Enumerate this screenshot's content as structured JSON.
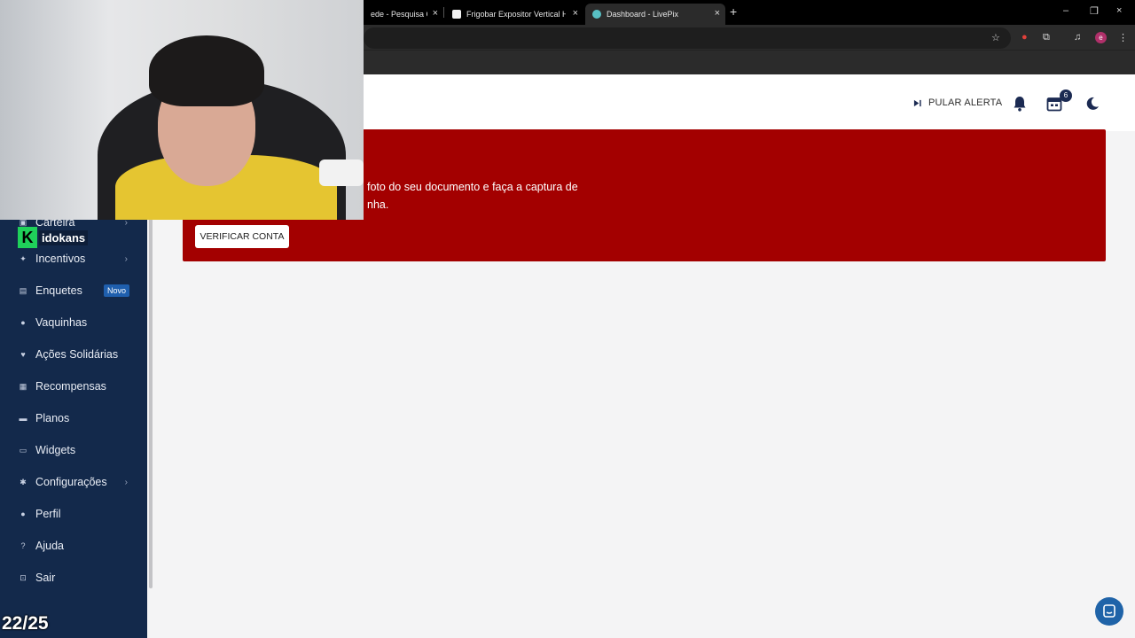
{
  "browser": {
    "tabs": [
      {
        "title": "ede - Pesquisa Go",
        "favicon_color": "#4285f4"
      },
      {
        "title": "Frigobar Expositor Vertical HQ",
        "favicon_color": "#f2f2f2"
      },
      {
        "title": "Dashboard - LivePix",
        "favicon_color": "#58c0c4"
      }
    ],
    "new_tab": "+",
    "close_glyph": "×",
    "window_controls": [
      "–",
      "❐",
      "×"
    ],
    "profile_initial": "e"
  },
  "topbar": {
    "skip_alert_label": "PULAR ALERTA",
    "calendar_badge": "6"
  },
  "alert": {
    "line1": "foto do seu documento e faça a captura de",
    "line2": "nha.",
    "verify_button": "VERIFICAR CONTA"
  },
  "sidebar": {
    "partial_item": "Carteira",
    "items": [
      {
        "label": "Incentivos",
        "icon": "sparkle-icon",
        "has_submenu": true
      },
      {
        "label": "Enquetes",
        "icon": "poll-icon",
        "badge": "Novo"
      },
      {
        "label": "Vaquinhas",
        "icon": "piggy-bank-icon"
      },
      {
        "label": "Ações Solidárias",
        "icon": "hand-heart-icon"
      },
      {
        "label": "Recompensas",
        "icon": "gift-icon"
      },
      {
        "label": "Planos",
        "icon": "ticket-icon"
      },
      {
        "label": "Widgets",
        "icon": "monitor-icon"
      },
      {
        "label": "Configurações",
        "icon": "gear-icon",
        "has_submenu": true
      },
      {
        "label": "Perfil",
        "icon": "user-icon"
      },
      {
        "label": "Ajuda",
        "icon": "help-icon"
      },
      {
        "label": "Sair",
        "icon": "logout-icon"
      }
    ]
  },
  "overlay": {
    "brand_letter": "K",
    "brand_name": "idokans",
    "sub_counter": "22/25"
  },
  "colors": {
    "sidebar": "#13294b",
    "alert": "#a30000",
    "accent": "#1f63a8"
  }
}
